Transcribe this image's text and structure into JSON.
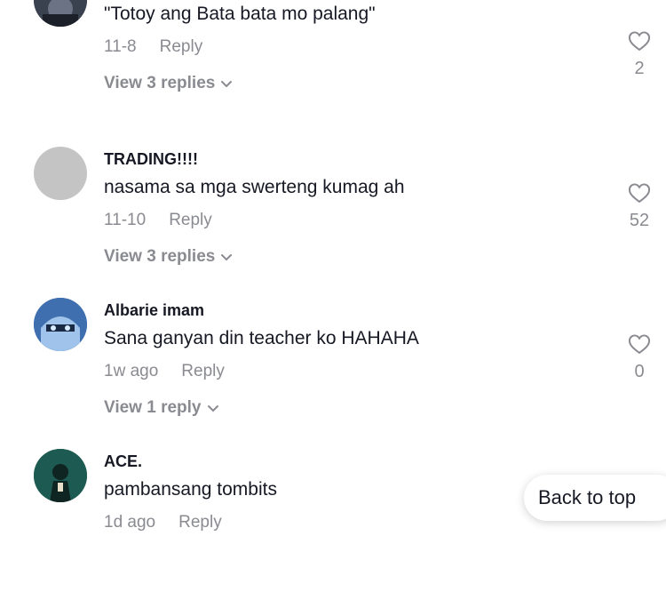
{
  "comments": [
    {
      "username": "",
      "text": "\"Totoy ang Bata bata mo palang\"",
      "date": "11-8",
      "reply_label": "Reply",
      "view_replies": "View 3 replies",
      "likes": "2",
      "avatar_color": "#2a2f3a"
    },
    {
      "username": "TRADING!!!!",
      "text": "nasama sa mga swerteng kumag ah",
      "date": "11-10",
      "reply_label": "Reply",
      "view_replies": "View 3 replies",
      "likes": "52",
      "avatar_color": "#c4c4c4"
    },
    {
      "username": "Albarie imam",
      "text": "Sana ganyan din teacher ko HAHAHA",
      "date": "1w ago",
      "reply_label": "Reply",
      "view_replies": "View 1 reply",
      "likes": "0",
      "avatar_color": "#4a78b8"
    },
    {
      "username": "ACE.",
      "text": "pambansang tombits",
      "date": "1d ago",
      "reply_label": "Reply",
      "likes": "",
      "avatar_color": "#1f5f56"
    }
  ],
  "back_to_top": "Back to top",
  "icons": {
    "like": "heart-outline-icon",
    "expand": "chevron-down-icon"
  }
}
